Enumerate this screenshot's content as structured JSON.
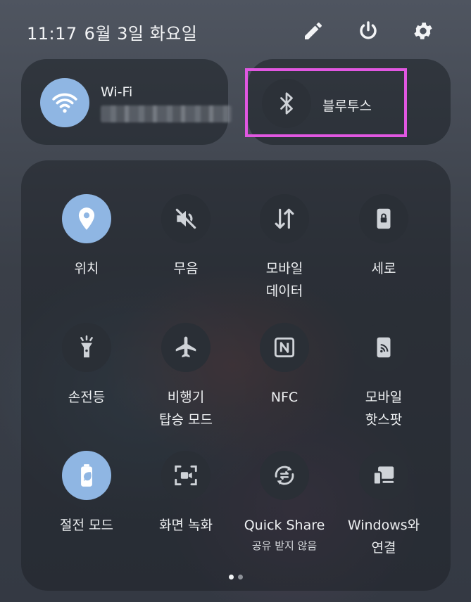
{
  "status": {
    "time": "11:17",
    "date": "6월 3일 화요일"
  },
  "wifi": {
    "label": "Wi-Fi"
  },
  "bluetooth": {
    "label": "블루투스"
  },
  "tiles": [
    {
      "label": "위치",
      "icon": "location-pin-icon",
      "active": true
    },
    {
      "label": "무음",
      "icon": "mute-icon",
      "active": false
    },
    {
      "label": "모바일\n데이터",
      "icon": "data-transfer-icon",
      "active": false
    },
    {
      "label": "세로",
      "icon": "portrait-lock-icon",
      "active": false
    },
    {
      "label": "손전등",
      "icon": "flashlight-icon",
      "active": false
    },
    {
      "label": "비행기\n탑승 모드",
      "icon": "airplane-icon",
      "active": false
    },
    {
      "label": "NFC",
      "icon": "nfc-icon",
      "active": false
    },
    {
      "label": "모바일\n핫스팟",
      "icon": "hotspot-icon",
      "active": false
    },
    {
      "label": "절전 모드",
      "icon": "battery-saver-icon",
      "active": true
    },
    {
      "label": "화면 녹화",
      "icon": "screen-record-icon",
      "active": false
    },
    {
      "label": "Quick Share",
      "sub": "공유 받지 않음",
      "icon": "quick-share-icon",
      "active": false
    },
    {
      "label": "Windows와\n연결",
      "icon": "windows-link-icon",
      "active": false
    }
  ],
  "pager": {
    "pages": 2,
    "current": 1
  },
  "colors": {
    "accent": "#8fb6e3",
    "tile_off": "#2a2f36",
    "highlight": "#e157e1"
  }
}
